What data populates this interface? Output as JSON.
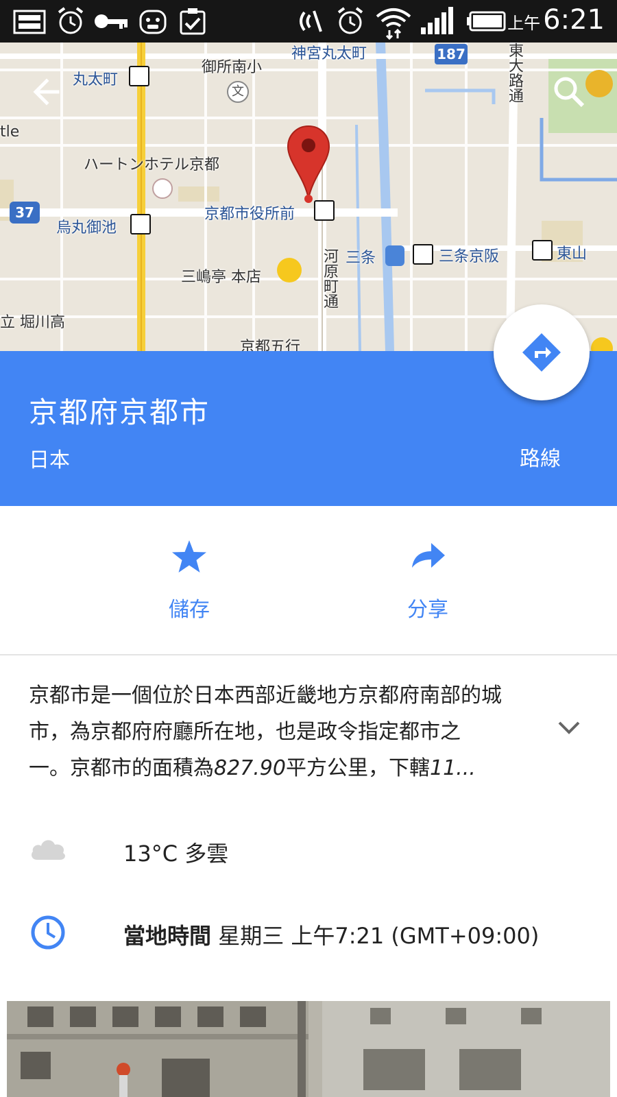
{
  "status_bar": {
    "ampm": "上午",
    "time": "6:21"
  },
  "map": {
    "labels": {
      "jingu_marutamachi": "神宮丸太町",
      "gosho_minami": "御所南小",
      "marutamachi": "丸太町",
      "route_187": "187",
      "higashioji": "東大路通",
      "partial_left": "tle",
      "harton_hotel": "ハートンホテル京都",
      "route_37": "37",
      "karasuma_oike": "烏丸御池",
      "kyoto_shiyakusho_mae": "京都市役所前",
      "sanjo": "三条",
      "sanjo_keihan": "三条京阪",
      "higashiyama": "東山",
      "mishimatei": "三嶋亭 本店",
      "kawaramachi": "河原町通",
      "horikawa": "立 堀川高",
      "partial_bottom": "京都五行"
    },
    "school_icon_glyph": "文"
  },
  "place": {
    "title": "京都府京都市",
    "subtitle": "日本",
    "route_label": "路線"
  },
  "actions": {
    "save_label": "儲存",
    "share_label": "分享"
  },
  "description": {
    "line1": "京都市是一個位於日本西部近畿地方京都府南部的城",
    "line2": "市，為京都府府廳所在地，也是政令指定都市之",
    "line3_a": "一。京都市的面積為",
    "line3_b": "827.90",
    "line3_c": "平方公里，下轄",
    "line3_d": "11..."
  },
  "weather": {
    "text": "13°C 多雲"
  },
  "local_time": {
    "label": "當地時間",
    "value": "星期三 上午7:21 (GMT+09:00)"
  },
  "colors": {
    "accent_blue": "#4285f4",
    "pin_red": "#d7342b",
    "status_bar": "#161616"
  },
  "icons": {
    "back": "arrow-left-icon",
    "search": "search-icon",
    "directions": "directions-icon",
    "save": "star-icon",
    "share": "share-arrow-icon",
    "expand": "chevron-down-icon",
    "weather": "cloud-icon",
    "time": "clock-icon"
  }
}
